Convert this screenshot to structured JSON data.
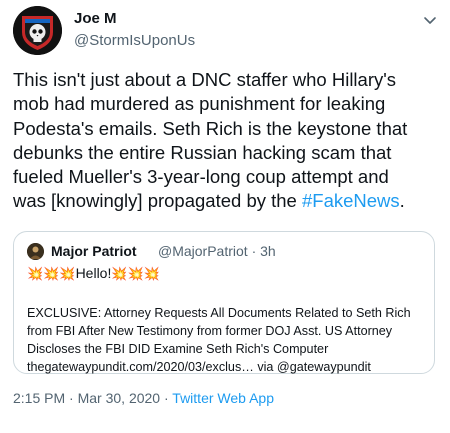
{
  "author": {
    "display_name": "Joe M",
    "handle": "@StormIsUponUs",
    "avatar_icon": "shield-skull-avatar-icon"
  },
  "menu_icon": "chevron-down-icon",
  "body": {
    "lines": [
      "This isn't just about a DNC staffer who Hillary's",
      "mob had murdered as punishment for leaking",
      "Podesta's emails. Seth Rich is the keystone that",
      "debunks the entire Russian hacking scam that",
      "fueled Mueller's 3-year-long coup attempt and"
    ],
    "last_line_prefix": "was [knowingly] propagated by the ",
    "hashtag": "#FakeNews",
    "last_line_suffix": "."
  },
  "quote": {
    "author_name": "Major Patriot",
    "author_handle": "@MajorPatriot",
    "separator": "·",
    "time": "3h",
    "hello_prefix": "💥💥💥",
    "hello_text": "Hello!",
    "hello_suffix": "💥💥💥",
    "lines": [
      "EXCLUSIVE: Attorney Requests All Documents Related to Seth Rich",
      "from FBI After New Testimony from former DOJ Asst. US Attorney",
      "Discloses the FBI DID Examine Seth Rich's Computer",
      "thegatewaypundit.com/2020/03/exclus… via @gatewaypundit"
    ]
  },
  "footer": {
    "time": "2:15 PM",
    "sep": "·",
    "date": "Mar 30, 2020",
    "source": "Twitter Web App"
  },
  "colors": {
    "link": "#1d9bf0",
    "muted": "#536471",
    "text": "#0f1419",
    "border": "#cfd9de"
  }
}
